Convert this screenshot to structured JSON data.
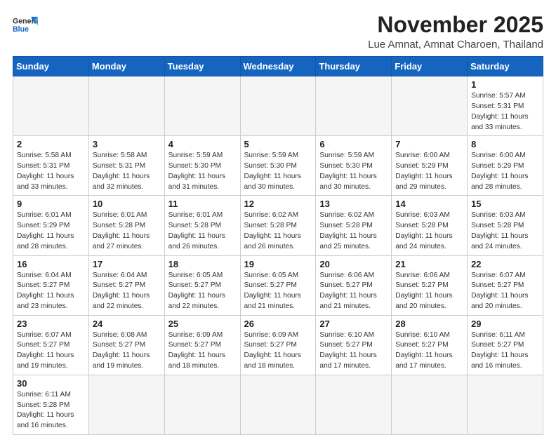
{
  "logo": {
    "text_general": "General",
    "text_blue": "Blue"
  },
  "title": "November 2025",
  "location": "Lue Amnat, Amnat Charoen, Thailand",
  "days_of_week": [
    "Sunday",
    "Monday",
    "Tuesday",
    "Wednesday",
    "Thursday",
    "Friday",
    "Saturday"
  ],
  "weeks": [
    [
      {
        "day": "",
        "info": ""
      },
      {
        "day": "",
        "info": ""
      },
      {
        "day": "",
        "info": ""
      },
      {
        "day": "",
        "info": ""
      },
      {
        "day": "",
        "info": ""
      },
      {
        "day": "",
        "info": ""
      },
      {
        "day": "1",
        "info": "Sunrise: 5:57 AM\nSunset: 5:31 PM\nDaylight: 11 hours\nand 33 minutes."
      }
    ],
    [
      {
        "day": "2",
        "info": "Sunrise: 5:58 AM\nSunset: 5:31 PM\nDaylight: 11 hours\nand 33 minutes."
      },
      {
        "day": "3",
        "info": "Sunrise: 5:58 AM\nSunset: 5:31 PM\nDaylight: 11 hours\nand 32 minutes."
      },
      {
        "day": "4",
        "info": "Sunrise: 5:59 AM\nSunset: 5:30 PM\nDaylight: 11 hours\nand 31 minutes."
      },
      {
        "day": "5",
        "info": "Sunrise: 5:59 AM\nSunset: 5:30 PM\nDaylight: 11 hours\nand 30 minutes."
      },
      {
        "day": "6",
        "info": "Sunrise: 5:59 AM\nSunset: 5:30 PM\nDaylight: 11 hours\nand 30 minutes."
      },
      {
        "day": "7",
        "info": "Sunrise: 6:00 AM\nSunset: 5:29 PM\nDaylight: 11 hours\nand 29 minutes."
      },
      {
        "day": "8",
        "info": "Sunrise: 6:00 AM\nSunset: 5:29 PM\nDaylight: 11 hours\nand 28 minutes."
      }
    ],
    [
      {
        "day": "9",
        "info": "Sunrise: 6:01 AM\nSunset: 5:29 PM\nDaylight: 11 hours\nand 28 minutes."
      },
      {
        "day": "10",
        "info": "Sunrise: 6:01 AM\nSunset: 5:28 PM\nDaylight: 11 hours\nand 27 minutes."
      },
      {
        "day": "11",
        "info": "Sunrise: 6:01 AM\nSunset: 5:28 PM\nDaylight: 11 hours\nand 26 minutes."
      },
      {
        "day": "12",
        "info": "Sunrise: 6:02 AM\nSunset: 5:28 PM\nDaylight: 11 hours\nand 26 minutes."
      },
      {
        "day": "13",
        "info": "Sunrise: 6:02 AM\nSunset: 5:28 PM\nDaylight: 11 hours\nand 25 minutes."
      },
      {
        "day": "14",
        "info": "Sunrise: 6:03 AM\nSunset: 5:28 PM\nDaylight: 11 hours\nand 24 minutes."
      },
      {
        "day": "15",
        "info": "Sunrise: 6:03 AM\nSunset: 5:28 PM\nDaylight: 11 hours\nand 24 minutes."
      }
    ],
    [
      {
        "day": "16",
        "info": "Sunrise: 6:04 AM\nSunset: 5:27 PM\nDaylight: 11 hours\nand 23 minutes."
      },
      {
        "day": "17",
        "info": "Sunrise: 6:04 AM\nSunset: 5:27 PM\nDaylight: 11 hours\nand 22 minutes."
      },
      {
        "day": "18",
        "info": "Sunrise: 6:05 AM\nSunset: 5:27 PM\nDaylight: 11 hours\nand 22 minutes."
      },
      {
        "day": "19",
        "info": "Sunrise: 6:05 AM\nSunset: 5:27 PM\nDaylight: 11 hours\nand 21 minutes."
      },
      {
        "day": "20",
        "info": "Sunrise: 6:06 AM\nSunset: 5:27 PM\nDaylight: 11 hours\nand 21 minutes."
      },
      {
        "day": "21",
        "info": "Sunrise: 6:06 AM\nSunset: 5:27 PM\nDaylight: 11 hours\nand 20 minutes."
      },
      {
        "day": "22",
        "info": "Sunrise: 6:07 AM\nSunset: 5:27 PM\nDaylight: 11 hours\nand 20 minutes."
      }
    ],
    [
      {
        "day": "23",
        "info": "Sunrise: 6:07 AM\nSunset: 5:27 PM\nDaylight: 11 hours\nand 19 minutes."
      },
      {
        "day": "24",
        "info": "Sunrise: 6:08 AM\nSunset: 5:27 PM\nDaylight: 11 hours\nand 19 minutes."
      },
      {
        "day": "25",
        "info": "Sunrise: 6:09 AM\nSunset: 5:27 PM\nDaylight: 11 hours\nand 18 minutes."
      },
      {
        "day": "26",
        "info": "Sunrise: 6:09 AM\nSunset: 5:27 PM\nDaylight: 11 hours\nand 18 minutes."
      },
      {
        "day": "27",
        "info": "Sunrise: 6:10 AM\nSunset: 5:27 PM\nDaylight: 11 hours\nand 17 minutes."
      },
      {
        "day": "28",
        "info": "Sunrise: 6:10 AM\nSunset: 5:27 PM\nDaylight: 11 hours\nand 17 minutes."
      },
      {
        "day": "29",
        "info": "Sunrise: 6:11 AM\nSunset: 5:27 PM\nDaylight: 11 hours\nand 16 minutes."
      }
    ],
    [
      {
        "day": "30",
        "info": "Sunrise: 6:11 AM\nSunset: 5:28 PM\nDaylight: 11 hours\nand 16 minutes."
      },
      {
        "day": "",
        "info": ""
      },
      {
        "day": "",
        "info": ""
      },
      {
        "day": "",
        "info": ""
      },
      {
        "day": "",
        "info": ""
      },
      {
        "day": "",
        "info": ""
      },
      {
        "day": "",
        "info": ""
      }
    ]
  ]
}
